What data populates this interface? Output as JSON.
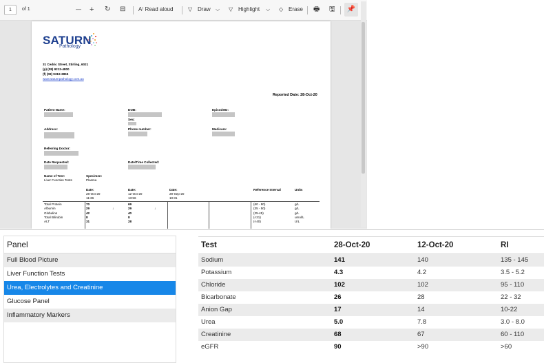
{
  "toolbar": {
    "page_number": "1",
    "page_of": "of 1",
    "zoom_out": "—",
    "zoom_in": "+",
    "rotate_icon": "↻",
    "fit_icon": "⊟",
    "read_aloud": "A⁾ Read aloud",
    "draw": "Draw",
    "highlight": "Highlight",
    "erase": "Erase",
    "print_icon": "🖶",
    "save_icon": "🖫",
    "pin_icon": "📌",
    "chev": "⌵"
  },
  "report": {
    "logo_main": "SATURN",
    "logo_sub": "Pathology",
    "address_line": "31 Cedric Street, Stirling, 6021",
    "phone": "(p) (08) 9213-4800",
    "fax": "(f) (08) 9319-3855",
    "website": "www.saturnpathology.com.au",
    "reported_date": "Reported Date: 28-Oct-20",
    "patient_name_label": "Patient Name:",
    "dob_label": "DOB:",
    "sex_label": "Sex:",
    "episode_label": "EpisodeID:",
    "address_label": "Address:",
    "phone_label": "Phone number:",
    "medicare_label": "Medicare:",
    "referring_label": "Referring Doctor:",
    "date_requested_label": "Date Requested:",
    "date_collected_label": "Date/Time Collected:",
    "name_of_test_label": "Name of Test:",
    "name_of_test_value": "Liver Function Tests",
    "specimen_label": "Specimen:",
    "specimen_value": "Plasma",
    "date_label": "Date:",
    "col1_date": "28-Oct-20",
    "col1_time": "11:36",
    "col2_date": "12-Oct-20",
    "col2_time": "13:56",
    "col3_date": "29-Sep-20",
    "col3_time": "10:31",
    "ref_interval_label": "Reference Interval",
    "units_label": "Units",
    "rows": [
      {
        "name": "Total Protein",
        "v1": "70",
        "v2": "69",
        "flag1": "",
        "flag2": "",
        "ref": "(60 - 80)",
        "unit": "g/L"
      },
      {
        "name": "Albumin",
        "v1": "29",
        "v2": "29",
        "flag1": "↓",
        "flag2": "↓",
        "ref": "(35 - 50)",
        "unit": "g/L"
      },
      {
        "name": "Globulins",
        "v1": "42",
        "v2": "40",
        "flag1": "",
        "flag2": "",
        "ref": "(25-45)",
        "unit": "g/L"
      },
      {
        "name": "Total Bilirubin",
        "v1": "8",
        "v2": "8",
        "flag1": "",
        "flag2": "",
        "ref": "(<21)",
        "unit": "umol/L"
      },
      {
        "name": "ALT",
        "v1": "31",
        "v2": "28",
        "flag1": "",
        "flag2": "",
        "ref": "(<40)",
        "unit": "U/L"
      }
    ]
  },
  "panel": {
    "header": "Panel",
    "items": [
      "Full Blood Picture",
      "Liver Function Tests",
      "Urea, Electrolytes and Creatinine",
      "Glucose Panel",
      "Inflammatory Markers"
    ],
    "selected_index": 2
  },
  "results": {
    "headers": [
      "Test",
      "28-Oct-20",
      "12-Oct-20",
      "RI"
    ],
    "rows": [
      [
        "Sodium",
        "141",
        "140",
        "135 - 145"
      ],
      [
        "Potassium",
        "4.3",
        "4.2",
        "3.5 - 5.2"
      ],
      [
        "Chloride",
        "102",
        "102",
        "95 - 110"
      ],
      [
        "Bicarbonate",
        "26",
        "28",
        "22 - 32"
      ],
      [
        "Anion Gap",
        "17",
        "14",
        "10-22"
      ],
      [
        "Urea",
        "5.0",
        "7.8",
        "3.0 - 8.0"
      ],
      [
        "Creatinine",
        "68",
        "67",
        "60 - 110"
      ],
      [
        "eGFR",
        "90",
        ">90",
        ">60"
      ]
    ]
  },
  "colors": {
    "selected": "#1787e8",
    "row_alt": "#ebebeb",
    "logo": "#1d3f8f"
  }
}
